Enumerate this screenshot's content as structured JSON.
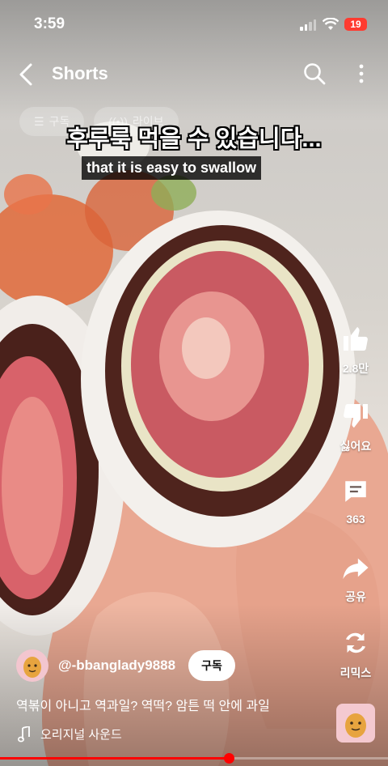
{
  "status_bar": {
    "time": "3:59",
    "battery": "19"
  },
  "header": {
    "title": "Shorts"
  },
  "chips": [
    "구독",
    "라이브"
  ],
  "subtitle": {
    "korean": "후루룩 먹을 수 있습니다...",
    "english": "that it is easy to swallow"
  },
  "actions": {
    "like": {
      "label": "2.8만",
      "icon": "thumbs-up-icon"
    },
    "dislike": {
      "label": "싫어요",
      "icon": "thumbs-down-icon"
    },
    "comments": {
      "label": "363",
      "icon": "comment-icon"
    },
    "share": {
      "label": "공유",
      "icon": "share-icon"
    },
    "remix": {
      "label": "리믹스",
      "icon": "remix-icon"
    }
  },
  "channel": {
    "handle": "@-bbanglady9888",
    "subscribe_label": "구독"
  },
  "caption": "역볶이 아니고 역과일? 역떡? 암튼 떡 안에 과일",
  "sound": {
    "label": "오리지널 사운드"
  },
  "progress": {
    "fraction": 0.59
  },
  "colors": {
    "accent": "#ff0000",
    "battery": "#ff3b30"
  }
}
